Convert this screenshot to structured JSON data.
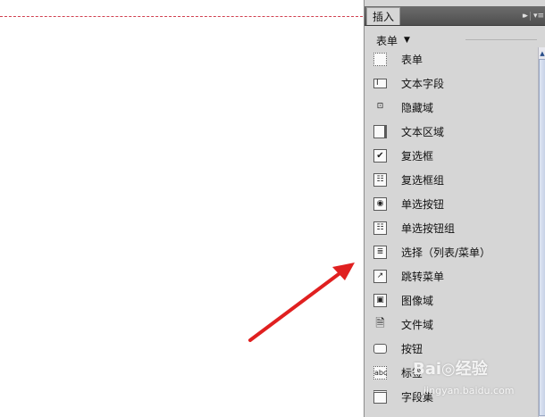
{
  "panel": {
    "tab_label": "插入",
    "collapse_glyph": "▸▸",
    "menu_glyph": "▾≡",
    "category_label": "表单",
    "category_arrow": "▼"
  },
  "items": [
    {
      "label": "表单",
      "icon": "form-icon",
      "glyph": ""
    },
    {
      "label": "文本字段",
      "icon": "text-field-icon",
      "glyph": "I"
    },
    {
      "label": "隐藏域",
      "icon": "hidden-field-icon",
      "glyph": "⊡"
    },
    {
      "label": "文本区域",
      "icon": "textarea-icon",
      "glyph": ""
    },
    {
      "label": "复选框",
      "icon": "checkbox-icon",
      "glyph": "✔"
    },
    {
      "label": "复选框组",
      "icon": "checkbox-group-icon",
      "glyph": "☷"
    },
    {
      "label": "单选按钮",
      "icon": "radio-button-icon",
      "glyph": "◉"
    },
    {
      "label": "单选按钮组",
      "icon": "radio-group-icon",
      "glyph": "☷"
    },
    {
      "label": "选择（列表/菜单）",
      "icon": "select-list-icon",
      "glyph": "≣"
    },
    {
      "label": "跳转菜单",
      "icon": "jump-menu-icon",
      "glyph": "↗"
    },
    {
      "label": "图像域",
      "icon": "image-field-icon",
      "glyph": "▣"
    },
    {
      "label": "文件域",
      "icon": "file-field-icon",
      "glyph": "🗎"
    },
    {
      "label": "按钮",
      "icon": "button-icon",
      "glyph": ""
    },
    {
      "label": "标签",
      "icon": "label-icon",
      "glyph": "abc"
    },
    {
      "label": "字段集",
      "icon": "fieldset-icon",
      "glyph": ""
    }
  ],
  "watermark": {
    "logo": "Bai◎经验",
    "url": "jingyan.baidu.com"
  },
  "colors": {
    "panel_bg": "#d6d6d6",
    "guide_line": "#d04050",
    "arrow": "#e02020"
  }
}
